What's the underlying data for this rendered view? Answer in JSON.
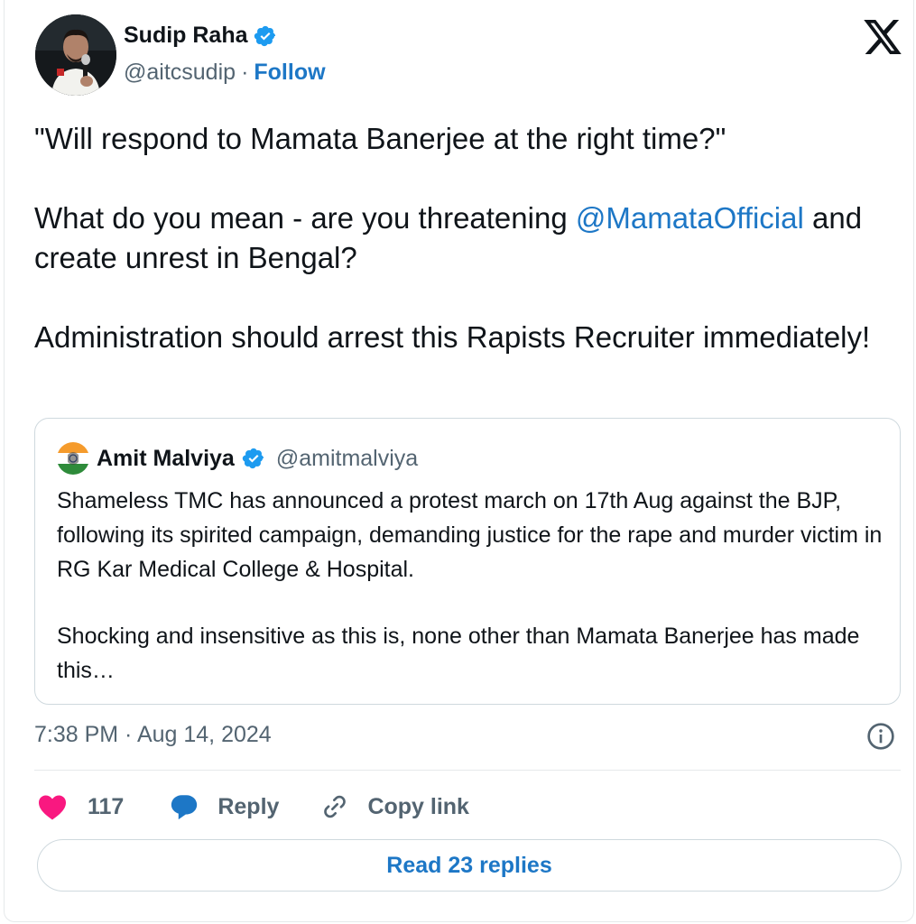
{
  "author": {
    "name": "Sudip Raha",
    "handle": "@aitcsudip",
    "separator": "·",
    "follow_label": "Follow",
    "avatar_icon": "profile-photo-speaker-with-microphone"
  },
  "logo_icon": "x-logo",
  "tweet": {
    "line1": "\"Will respond to Mamata Banerjee at the right time?\"",
    "line2_before": "What do you mean - are you threatening ",
    "mention": "@MamataOfficial",
    "line2_after": " and create unrest in Bengal?",
    "line3": "Administration should arrest this Rapists Recruiter immediately!"
  },
  "quoted_tweet": {
    "name": "Amit Malviya",
    "handle": "@amitmalviya",
    "avatar_icon": "indian-flag-avatar",
    "paragraph1": "Shameless TMC has announced a protest march on 17th Aug against the BJP, following its spirited campaign, demanding justice for the rape and murder victim in RG Kar Medical College & Hospital.",
    "paragraph2": "Shocking and insensitive as this is, none other than Mamata Banerjee has made this…"
  },
  "timestamp": "7:38 PM · Aug 14, 2024",
  "actions": {
    "like_count": "117",
    "reply_label": "Reply",
    "copy_link_label": "Copy link"
  },
  "read_replies_label": "Read 23 replies",
  "colors": {
    "accent_blue": "#1d77c6",
    "like_pink": "#f91880",
    "verified_blue": "#1d9bf0",
    "secondary_text": "#536471"
  }
}
